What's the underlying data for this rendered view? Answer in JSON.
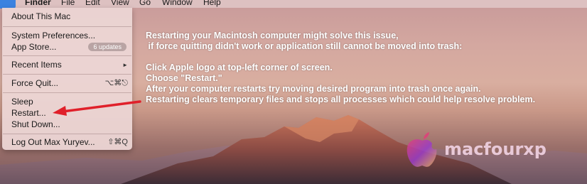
{
  "menubar": {
    "apple_glyph": "",
    "items": [
      "Finder",
      "File",
      "Edit",
      "View",
      "Go",
      "Window",
      "Help"
    ]
  },
  "apple_menu": {
    "about": "About This Mac",
    "system_prefs": "System Preferences...",
    "app_store": "App Store...",
    "app_store_badge": "6 updates",
    "recent_items": "Recent Items",
    "recent_items_arrow": "►",
    "force_quit": "Force Quit...",
    "force_quit_shortcut": "⌥⌘⎋",
    "sleep": "Sleep",
    "restart": "Restart...",
    "shut_down": "Shut Down...",
    "log_out": "Log Out Max Yuryev...",
    "log_out_shortcut": "⇧⌘Q"
  },
  "instructions": [
    "Restarting your Macintosh computer might solve this issue,",
    " if force quitting didn't work or application still cannot be moved into trash:",
    "",
    "Click Apple logo at top-left corner of screen.",
    "Choose \"Restart.\"",
    "After your computer restarts try moving desired program into trash once again.",
    "Restarting clears temporary files and stops all processes which could help resolve problem."
  ],
  "watermark": {
    "text": "macfourxp"
  },
  "colors": {
    "arrow": "#e0202a",
    "apple_highlight": "#3b82e0",
    "text": "#ffffff"
  }
}
